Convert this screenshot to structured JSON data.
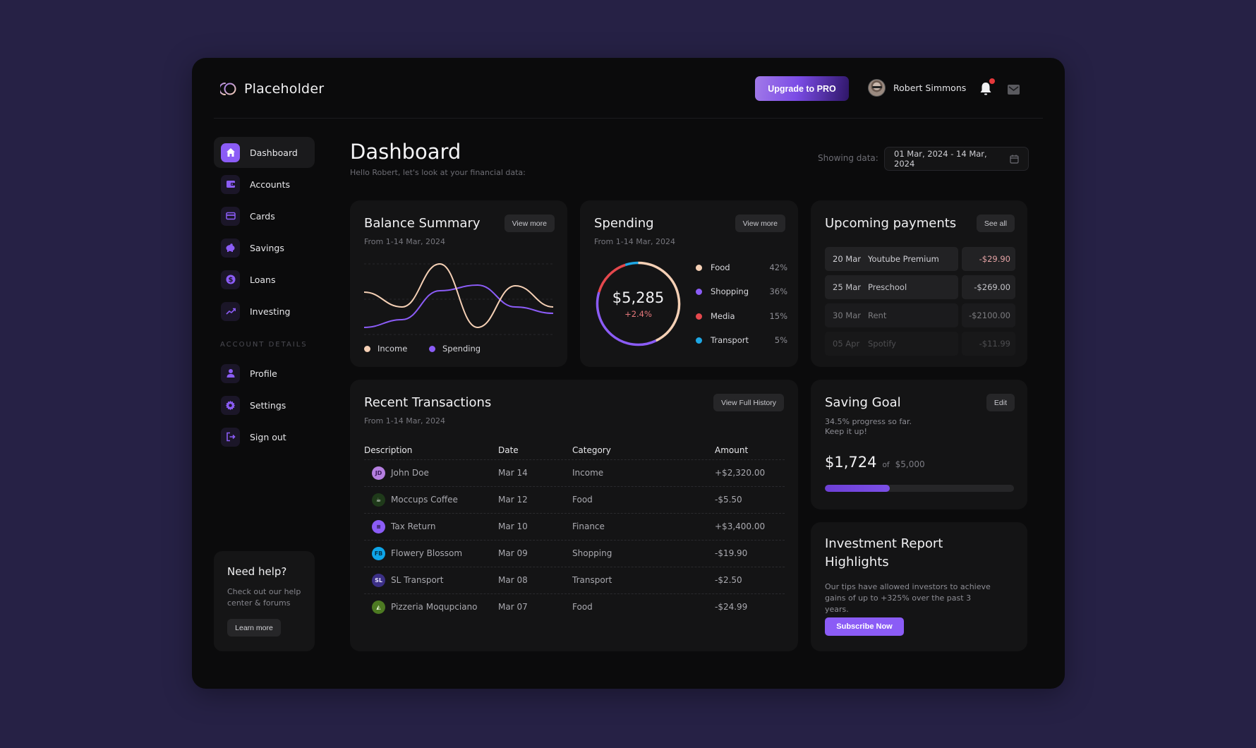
{
  "header": {
    "brand": "Placeholder",
    "upgrade_label": "Upgrade to PRO",
    "user_name": "Robert Simmons",
    "notification_badge": true
  },
  "colors": {
    "background": "#262145",
    "frame": "#0b0b0c",
    "card": "#141415",
    "accent": "#8b5cf6",
    "income": "#f5d0b5",
    "spending": "#8b5cf6",
    "media": "#e5484d",
    "transport": "#1ea7e4",
    "negative": "#e5787b"
  },
  "sidebar": {
    "items": [
      {
        "label": "Dashboard",
        "icon": "home-icon",
        "active": true
      },
      {
        "label": "Accounts",
        "icon": "wallet-icon",
        "active": false
      },
      {
        "label": "Cards",
        "icon": "credit-card-icon",
        "active": false
      },
      {
        "label": "Savings",
        "icon": "piggy-bank-icon",
        "active": false
      },
      {
        "label": "Loans",
        "icon": "dollar-coin-icon",
        "active": false
      },
      {
        "label": "Investing",
        "icon": "trending-up-icon",
        "active": false
      }
    ],
    "section_label": "ACCOUNT DETAILS",
    "account_items": [
      {
        "label": "Profile",
        "icon": "user-icon"
      },
      {
        "label": "Settings",
        "icon": "gear-icon"
      },
      {
        "label": "Sign out",
        "icon": "sign-out-icon"
      }
    ],
    "help": {
      "title": "Need help?",
      "text": "Check out our help center & forums",
      "button": "Learn more"
    }
  },
  "main": {
    "title": "Dashboard",
    "subtitle": "Hello Robert, let's look at your financial data:",
    "showing_label": "Showing data:",
    "date_range": "01 Mar, 2024 - 14 Mar, 2024"
  },
  "balance": {
    "title": "Balance Summary",
    "subtitle": "From 1-14 Mar, 2024",
    "button": "View more",
    "legend": [
      "Income",
      "Spending"
    ]
  },
  "spending": {
    "title": "Spending",
    "subtitle": "From 1-14 Mar, 2024",
    "button": "View more",
    "total": "$5,285",
    "change": "+2.4%",
    "categories": [
      {
        "label": "Food",
        "pct": "42%"
      },
      {
        "label": "Shopping",
        "pct": "36%"
      },
      {
        "label": "Media",
        "pct": "15%"
      },
      {
        "label": "Transport",
        "pct": "5%"
      }
    ]
  },
  "payments": {
    "title": "Upcoming payments",
    "button": "See all",
    "items": [
      {
        "date": "20 Mar",
        "name": "Youtube Premium",
        "amount": "-$29.90",
        "opacity": 1
      },
      {
        "date": "25 Mar",
        "name": "Preschool",
        "amount": "-$269.00",
        "opacity": 0.95
      },
      {
        "date": "30 Mar",
        "name": "Rent",
        "amount": "-$2100.00",
        "opacity": 0.55
      },
      {
        "date": "05 Apr",
        "name": "Spotify",
        "amount": "-$11.99",
        "opacity": 0.3
      }
    ]
  },
  "transactions": {
    "title": "Recent Transactions",
    "subtitle": "From 1-14 Mar, 2024",
    "button": "View Full History",
    "columns": [
      "Description",
      "Date",
      "Category",
      "Amount"
    ],
    "rows": [
      {
        "icon": "JD",
        "icon_bg": "#b57fe0",
        "icon_fg": "#3b1a5a",
        "description": "John Doe",
        "date": "Mar 14",
        "category": "Income",
        "amount": "+$2,320.00"
      },
      {
        "icon": "☕",
        "icon_bg": "#1f3a1a",
        "icon_fg": "#ffffff",
        "description": "Moccups Coffee",
        "date": "Mar 12",
        "category": "Food",
        "amount": "-$5.50"
      },
      {
        "icon": "≡",
        "icon_bg": "#8b5cf6",
        "icon_fg": "#1b1030",
        "description": "Tax Return",
        "date": "Mar 10",
        "category": "Finance",
        "amount": "+$3,400.00"
      },
      {
        "icon": "FB",
        "icon_bg": "#0ea5e9",
        "icon_fg": "#06324a",
        "description": "Flowery Blossom",
        "date": "Mar 09",
        "category": "Shopping",
        "amount": "-$19.90"
      },
      {
        "icon": "SL",
        "icon_bg": "#3b2f86",
        "icon_fg": "#e8e6ff",
        "description": "SL Transport",
        "date": "Mar 08",
        "category": "Transport",
        "amount": "-$2.50"
      },
      {
        "icon": "◭",
        "icon_bg": "#4d7a22",
        "icon_fg": "#e9f6d9",
        "description": "Pizzeria Moqupciano",
        "date": "Mar 07",
        "category": "Food",
        "amount": "-$24.99"
      }
    ]
  },
  "saving_goal": {
    "title": "Saving Goal",
    "button": "Edit",
    "text1": "34.5% progress so far.",
    "text2": "Keep it up!",
    "current": "$1,724",
    "of_label": "of",
    "target": "$5,000",
    "progress": 0.345
  },
  "investment": {
    "title": "Investment Report Highlights",
    "text": "Our tips have allowed investors to achieve gains of up to +325% over the past 3 years.",
    "button": "Subscribe Now"
  },
  "chart_data": [
    {
      "type": "line",
      "title": "Balance Summary",
      "x": [
        1,
        2,
        3,
        4,
        5,
        6
      ],
      "series": [
        {
          "name": "Income",
          "values": [
            60,
            39,
            100,
            10,
            69,
            39
          ]
        },
        {
          "name": "Spending",
          "values": [
            10,
            21,
            62,
            70,
            39,
            30
          ]
        }
      ],
      "ylim": [
        0,
        100
      ],
      "grid": true,
      "legend": "bottom-left",
      "xlabel": "",
      "ylabel": ""
    },
    {
      "type": "pie",
      "title": "Spending",
      "categories": [
        "Food",
        "Shopping",
        "Media",
        "Transport"
      ],
      "values": [
        42,
        36,
        15,
        5
      ],
      "center_label": "$5,285",
      "center_sublabel": "+2.4%",
      "legend": "right"
    }
  ]
}
